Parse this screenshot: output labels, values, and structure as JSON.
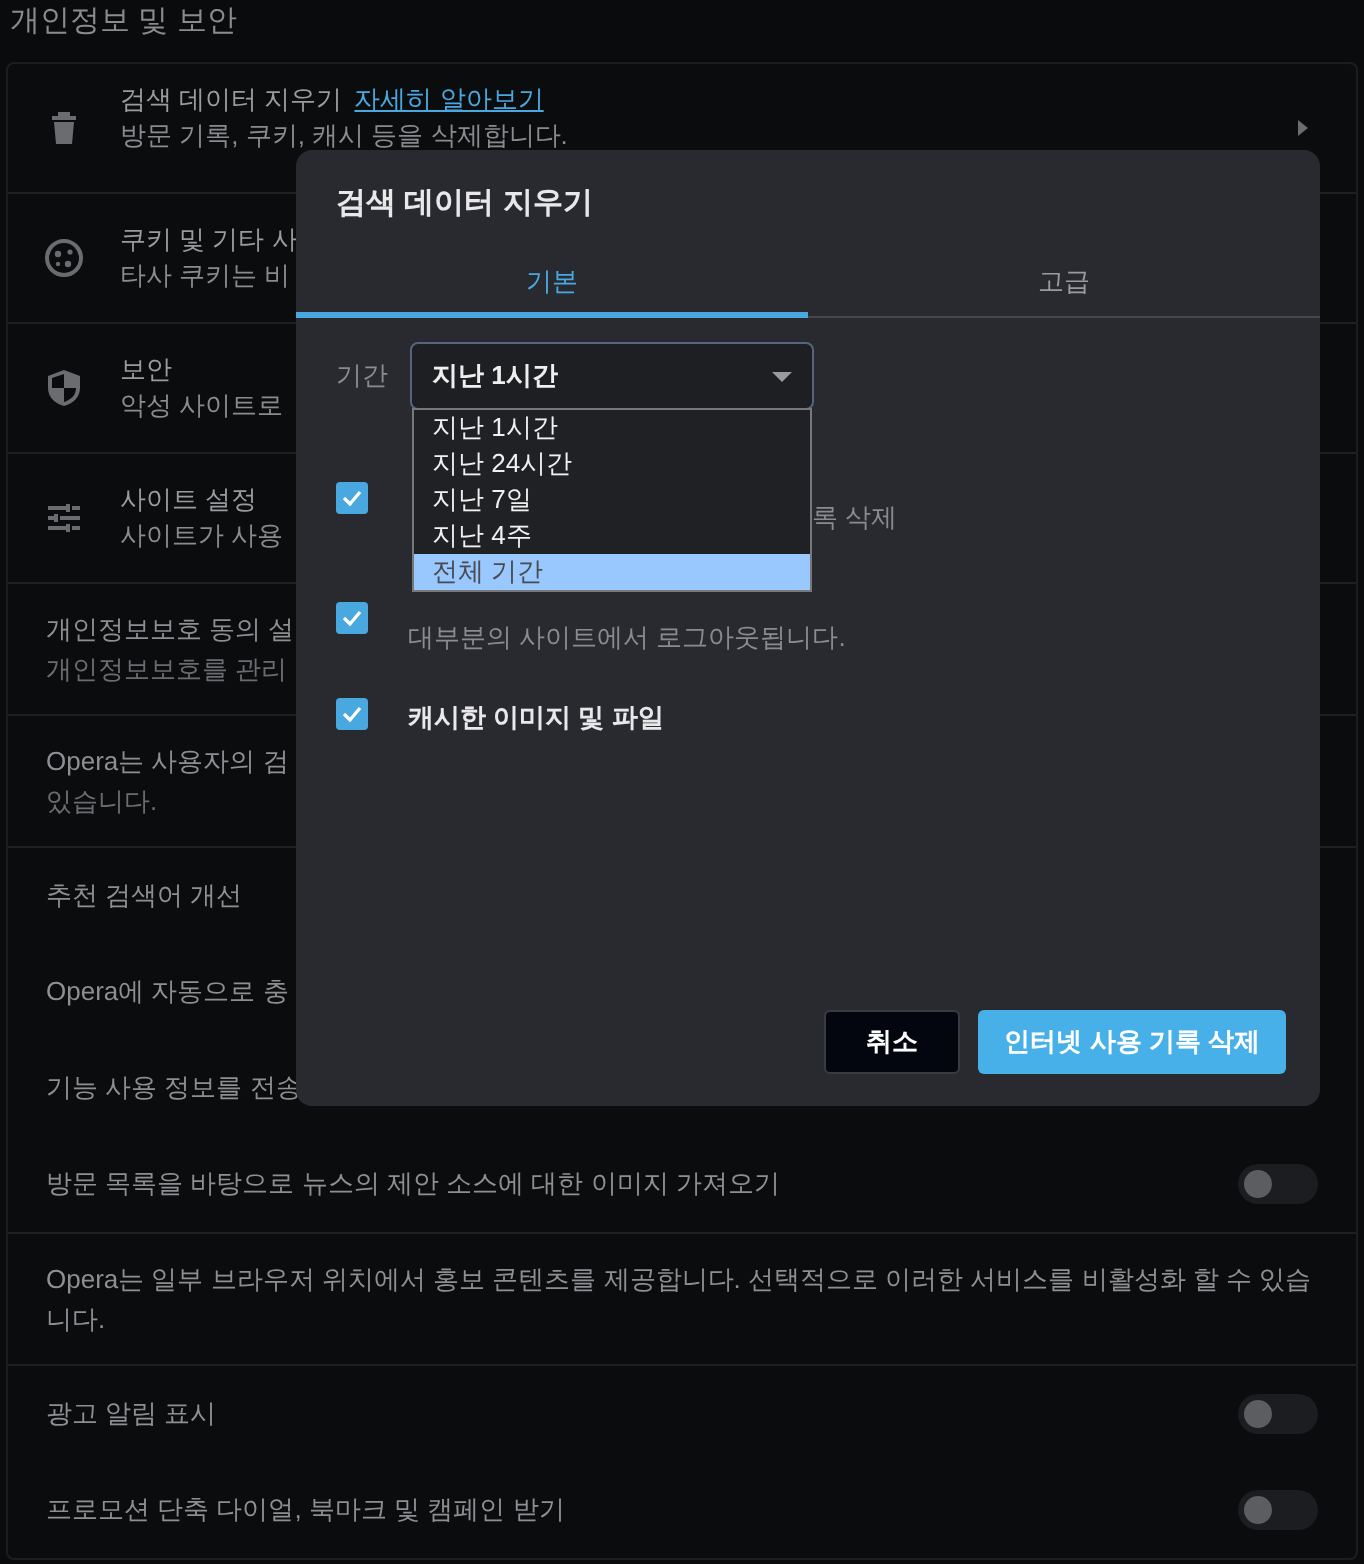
{
  "page_title": "개인정보 및 보안",
  "groups": [
    {
      "items": [
        {
          "kind": "icon_row",
          "title": "검색 데이터 지우기",
          "link": "자세히 알아보기",
          "subtitle": "방문 기록, 쿠키, 캐시 등을 삭제합니다.",
          "arrow": true
        }
      ]
    },
    {
      "items": [
        {
          "kind": "icon_row",
          "title": "쿠키 및 기타 사",
          "subtitle": "타사 쿠키는 비"
        }
      ]
    },
    {
      "items": [
        {
          "kind": "icon_row",
          "title": "보안",
          "subtitle": "악성 사이트로"
        }
      ]
    },
    {
      "items": [
        {
          "kind": "icon_row",
          "title": "사이트 설정",
          "subtitle": "사이트가 사용"
        }
      ]
    },
    {
      "items": [
        {
          "kind": "text_row",
          "title": "개인정보보호 동의 설",
          "subtitle": "개인정보보호를 관리"
        }
      ]
    },
    {
      "items": [
        {
          "kind": "text_row",
          "title": "Opera는 사용자의 검",
          "subtitle": "있습니다."
        }
      ]
    },
    {
      "items": [
        {
          "kind": "label_row",
          "title": "추천 검색어 개선"
        },
        {
          "kind": "label_row",
          "title": "Opera에 자동으로 충"
        },
        {
          "kind": "label_row",
          "title": "기능 사용 정보를 전송"
        },
        {
          "kind": "toggle_row",
          "title": "방문 목록을 바탕으로 뉴스의 제안 소스에 대한 이미지 가져오기",
          "on": false
        }
      ]
    },
    {
      "items": [
        {
          "kind": "text_row",
          "title": "Opera는 일부 브라우저 위치에서 홍보 콘텐츠를 제공합니다. 선택적으로 이러한 서비스를 비활성화 할 수 있습니다."
        }
      ]
    },
    {
      "items": [
        {
          "kind": "toggle_row",
          "title": "광고 알림 표시",
          "on": false
        },
        {
          "kind": "toggle_row",
          "title": "프로모션 단축 다이얼, 북마크 및 캠페인 받기",
          "on": false
        }
      ]
    }
  ],
  "dialog": {
    "title": "검색 데이터 지우기",
    "tabs": [
      {
        "label": "기본",
        "selected": true
      },
      {
        "label": "고급",
        "selected": false
      }
    ],
    "period": {
      "label": "기간",
      "value": "지난 1시간",
      "options": [
        {
          "label": "지난 1시간",
          "highlighted": false
        },
        {
          "label": "지난 24시간",
          "highlighted": false
        },
        {
          "label": "지난 7일",
          "highlighted": false
        },
        {
          "label": "지난 4주",
          "highlighted": false
        },
        {
          "label": "전체 기간",
          "highlighted": true
        }
      ]
    },
    "checks": [
      {
        "subtitle": "록 삭제",
        "checked": true
      },
      {
        "subtitle": "대부분의 사이트에서 로그아웃됩니다.",
        "checked": true
      },
      {
        "title": "캐시한 이미지 및 파일",
        "checked": true
      }
    ],
    "buttons": [
      {
        "kind": "secondary",
        "label": "취소"
      },
      {
        "kind": "primary",
        "label": "인터넷 사용 기록 삭제"
      }
    ]
  }
}
